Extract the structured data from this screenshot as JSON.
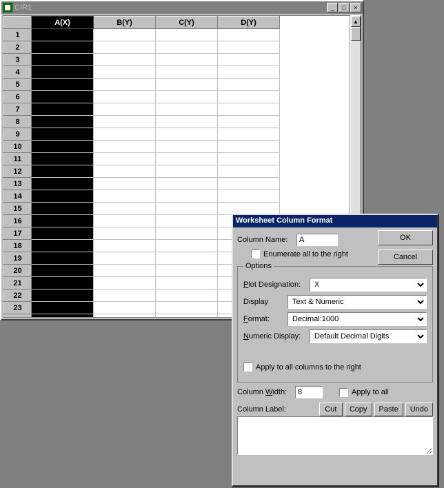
{
  "worksheet": {
    "title": "CIR1",
    "columns": [
      "A(X)",
      "B(Y)",
      "C(Y)",
      "D(Y)"
    ],
    "selected_col_index": 0,
    "row_count": 24
  },
  "dialog": {
    "title": "Worksheet Column Format",
    "column_name_label": "Column Name:",
    "column_name_value": "A",
    "enumerate_label": "Enumerate all to the right",
    "ok_label": "OK",
    "cancel_label": "Cancel",
    "options_legend": "Options",
    "plot_designation_label": "Plot Designation:",
    "plot_designation_value": "X",
    "display_label": "Display",
    "display_value": "Text & Numeric",
    "format_label": "Format:",
    "format_value": "Decimal:1000",
    "numeric_display_label": "Numeric Display:",
    "numeric_display_value": "Default Decimal Digits",
    "apply_all_cols_label": "Apply to all columns to the right",
    "column_width_label": "Column Width:",
    "column_width_value": "8",
    "apply_to_all_label": "Apply to all",
    "column_label_label": "Column Label:",
    "cut_label": "Cut",
    "copy_label": "Copy",
    "paste_label": "Paste",
    "undo_label": "Undo"
  }
}
